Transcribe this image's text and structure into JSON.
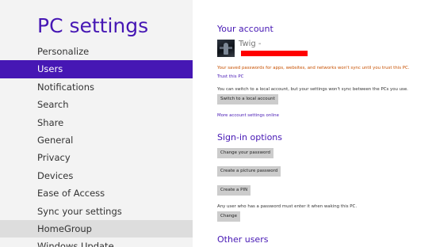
{
  "sidebar": {
    "title": "PC settings",
    "items": [
      {
        "label": "Personalize"
      },
      {
        "label": "Users"
      },
      {
        "label": "Notifications"
      },
      {
        "label": "Search"
      },
      {
        "label": "Share"
      },
      {
        "label": "General"
      },
      {
        "label": "Privacy"
      },
      {
        "label": "Devices"
      },
      {
        "label": "Ease of Access"
      },
      {
        "label": "Sync your settings"
      },
      {
        "label": "HomeGroup"
      },
      {
        "label": "Windows Update"
      }
    ],
    "selected": "Users",
    "hovered": "HomeGroup"
  },
  "account": {
    "heading": "Your account",
    "username": "Twig -",
    "warning": "Your saved passwords for apps, websites, and networks won't sync until you trust this PC.",
    "trust_link": "Trust this PC",
    "local_text": "You can switch to a local account, but your settings won't sync between the PCs you use.",
    "local_button": "Switch to a local account",
    "more_link": "More account settings online"
  },
  "signin": {
    "heading": "Sign-in options",
    "change_password": "Change your password",
    "picture_password": "Create a picture password",
    "pin": "Create a PIN",
    "policy_text": "Any user who has a password must enter it when waking this PC.",
    "change_button": "Change"
  },
  "other_users": {
    "heading": "Other users"
  },
  "colors": {
    "accent": "#4617b4",
    "selected_bg": "#4617b4",
    "hover_bg": "#dddddd",
    "warning": "#c75000",
    "redaction": "#ff0000"
  }
}
